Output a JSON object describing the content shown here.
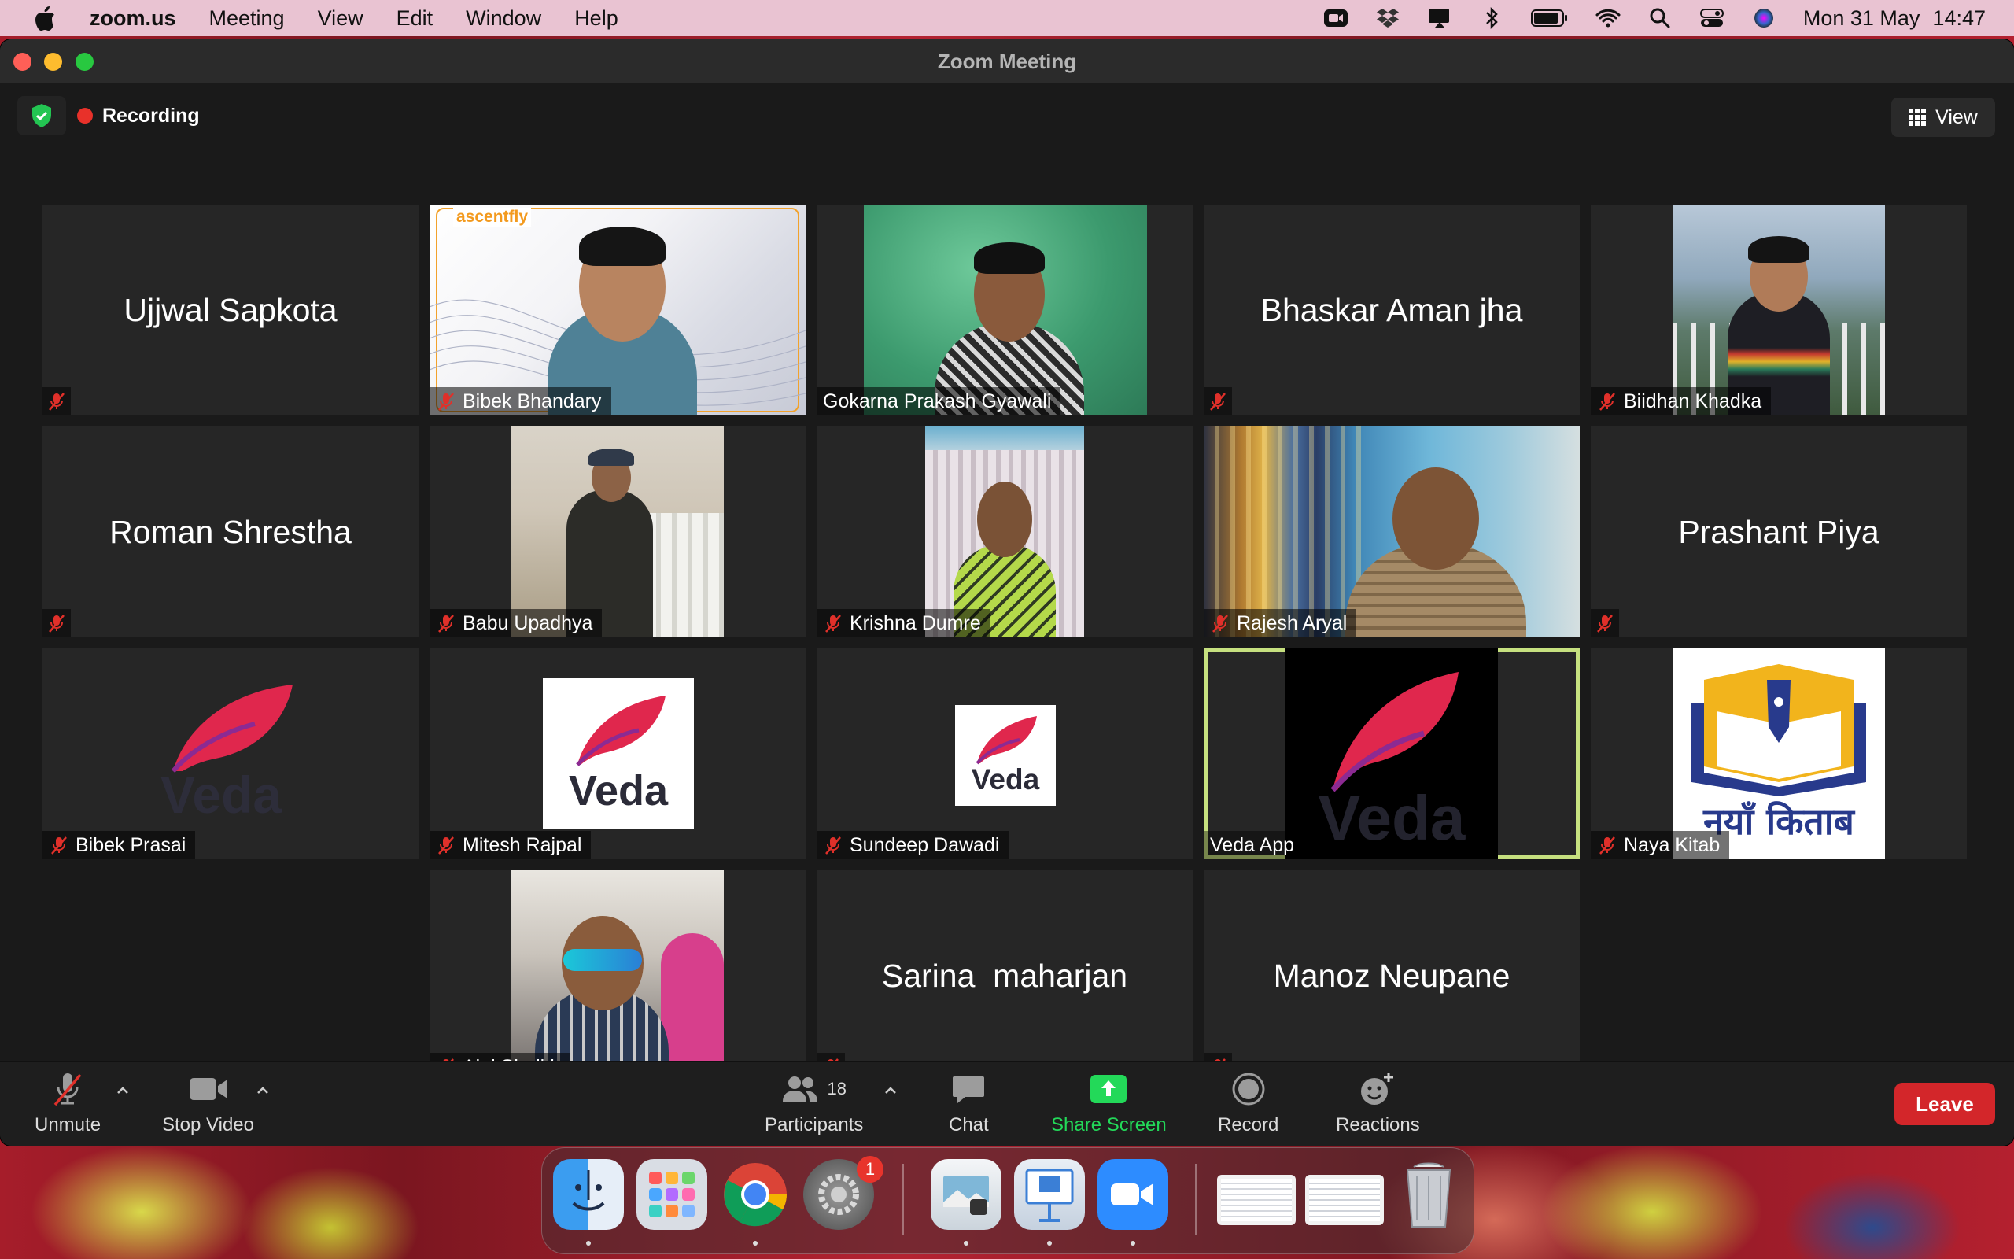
{
  "menubar": {
    "app_name": "zoom.us",
    "menus": [
      "Meeting",
      "View",
      "Edit",
      "Window",
      "Help"
    ],
    "date": "Mon 31 May",
    "time": "14:47",
    "status_icons": [
      "zoom-status-icon",
      "dropbox-icon",
      "screen-mirror-icon",
      "bluetooth-icon",
      "battery-icon",
      "wifi-icon",
      "spotlight-search-icon",
      "control-center-icon",
      "siri-icon"
    ]
  },
  "window": {
    "title": "Zoom Meeting",
    "recording_label": "Recording",
    "view_label": "View"
  },
  "participants": [
    {
      "name": "Ujjwal Sapkota",
      "kind": "name-only",
      "muted": true
    },
    {
      "name": "Bibek Bhandary",
      "kind": "video",
      "muted": true
    },
    {
      "name": "Gokarna Prakash Gyawali",
      "kind": "video",
      "muted": false
    },
    {
      "name": "Bhaskar Aman jha",
      "kind": "name-only",
      "muted": true
    },
    {
      "name": "Biidhan Khadka",
      "kind": "video",
      "muted": true
    },
    {
      "name": "Roman Shrestha",
      "kind": "name-only",
      "muted": true
    },
    {
      "name": "Babu Upadhya",
      "kind": "video",
      "muted": true
    },
    {
      "name": "Krishna Dumre",
      "kind": "video",
      "muted": true
    },
    {
      "name": "Rajesh Aryal",
      "kind": "video",
      "muted": true
    },
    {
      "name": "Prashant Piya",
      "kind": "name-only",
      "muted": true
    },
    {
      "name": "Bibek Prasai",
      "kind": "logo",
      "muted": true
    },
    {
      "name": "Mitesh Rajpal",
      "kind": "logo",
      "muted": true
    },
    {
      "name": "Sundeep Dawadi",
      "kind": "logo",
      "muted": true
    },
    {
      "name": "Veda App",
      "kind": "logo",
      "muted": false,
      "active_speaker": true
    },
    {
      "name": "Naya Kitab",
      "kind": "logo",
      "muted": true
    },
    {
      "name": "Ajaj Sheikh",
      "kind": "video",
      "muted": true
    },
    {
      "name": "Sarina  maharjan",
      "kind": "name-only",
      "muted": true
    },
    {
      "name": "Manoz Neupane",
      "kind": "name-only",
      "muted": true
    }
  ],
  "logos": {
    "veda": "Veda",
    "naya_kitab": "नयाँ किताब",
    "ascentfly": "ascentfly"
  },
  "toolbar": {
    "unmute": "Unmute",
    "stop_video": "Stop Video",
    "participants": "Participants",
    "participants_count": "18",
    "chat": "Chat",
    "share_screen": "Share Screen",
    "record": "Record",
    "reactions": "Reactions",
    "leave": "Leave"
  },
  "dock": {
    "apps": [
      "Finder",
      "Launchpad",
      "Google Chrome",
      "System Preferences",
      "Preview",
      "Keynote",
      "Zoom"
    ],
    "system_preferences_badge": "1"
  },
  "colors": {
    "menubar_bg": "#e9c3d2",
    "tile_bg": "#262626",
    "active_speaker_border": "#c6e07f",
    "share_screen_green": "#23d959",
    "leave_red": "#d3262a",
    "veda_red": "#e0274d"
  }
}
